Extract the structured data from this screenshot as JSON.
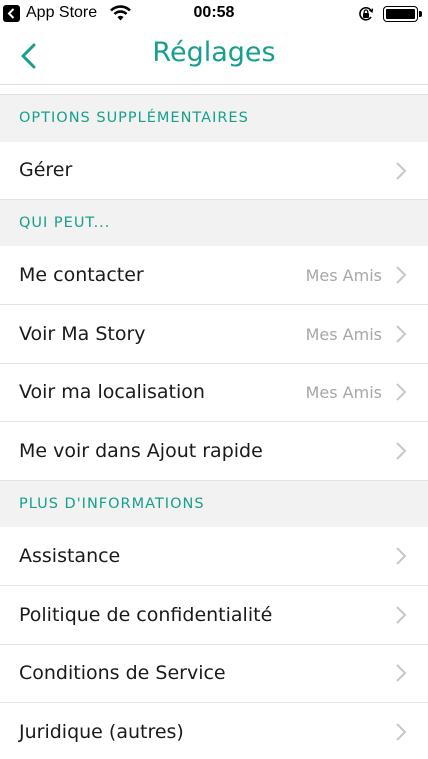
{
  "status_bar": {
    "app_label": "App Store",
    "time": "00:58"
  },
  "header": {
    "title": "Réglages"
  },
  "sections": {
    "options": {
      "title": "OPTIONS SUPPLÉMENTAIRES",
      "rows": [
        {
          "label": "Gérer",
          "value": ""
        }
      ]
    },
    "qui_peut": {
      "title": "QUI PEUT...",
      "rows": [
        {
          "label": "Me contacter",
          "value": "Mes Amis"
        },
        {
          "label": "Voir Ma Story",
          "value": "Mes Amis"
        },
        {
          "label": "Voir ma localisation",
          "value": "Mes Amis"
        },
        {
          "label": "Me voir dans Ajout rapide",
          "value": ""
        }
      ]
    },
    "plus_info": {
      "title": "PLUS D'INFORMATIONS",
      "rows": [
        {
          "label": "Assistance",
          "value": ""
        },
        {
          "label": "Politique de confidentialité",
          "value": ""
        },
        {
          "label": "Conditions de Service",
          "value": ""
        },
        {
          "label": "Juridique (autres)",
          "value": ""
        }
      ]
    }
  },
  "colors": {
    "accent": "#16a08c",
    "chevron": "#c7c7cc",
    "secondary_text": "#a7a7a7"
  },
  "icons": {
    "back": "chevron-left-icon",
    "row_disclosure": "chevron-right-icon"
  }
}
